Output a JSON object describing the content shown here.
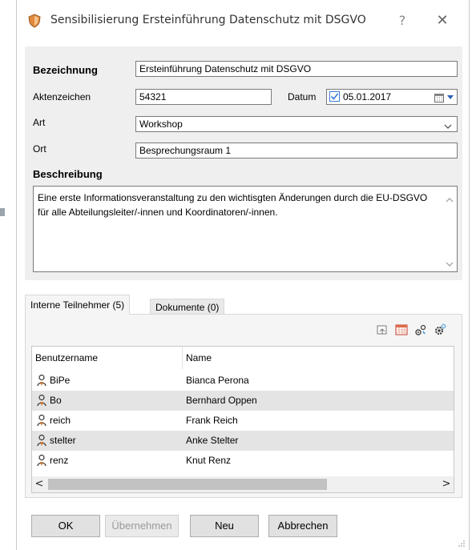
{
  "window": {
    "title": "Sensibilisierung Ersteinführung Datenschutz mit DSGVO",
    "help_label": "?",
    "close_label": "✕"
  },
  "form": {
    "bezeichnung_label": "Bezeichnung",
    "bezeichnung_value": "Ersteinführung Datenschutz mit DSGVO",
    "aktenzeichen_label": "Aktenzeichen",
    "aktenzeichen_value": "54321",
    "datum_label": "Datum",
    "datum_value": "05.01.2017",
    "datum_checked": true,
    "art_label": "Art",
    "art_value": "Workshop",
    "ort_label": "Ort",
    "ort_value": "Besprechungsraum 1",
    "beschreibung_label": "Beschreibung",
    "beschreibung_value": "Eine erste Informationsveranstaltung zu den wichtisgten Änderungen durch die EU-DSGVO für alle Abteilungsleiter/-innen und Koordinatoren/-innen."
  },
  "tabs": [
    {
      "label": "Interne Teilnehmer (5)",
      "active": true
    },
    {
      "label": "Dokumente (0)",
      "active": false
    }
  ],
  "toolbar_icons": [
    "import-icon",
    "calendar-grid-icon",
    "users-settings-icon",
    "gear-icon"
  ],
  "table": {
    "columns": [
      "Benutzername",
      "Name"
    ],
    "rows": [
      {
        "user": "BiPe",
        "name": "Bianca Perona"
      },
      {
        "user": "Bo",
        "name": "Bernhard Oppen"
      },
      {
        "user": "reich",
        "name": "Frank Reich"
      },
      {
        "user": "stelter",
        "name": "Anke Stelter"
      },
      {
        "user": "renz",
        "name": "Knut Renz"
      }
    ],
    "scroll_left": "<",
    "scroll_right": ">"
  },
  "buttons": {
    "ok": "OK",
    "apply": "Übernehmen",
    "new": "Neu",
    "cancel": "Abbrechen"
  },
  "colors": {
    "accent": "#3a7bd5",
    "group_bg": "#efefef",
    "row_alt": "#e4e4e4"
  }
}
